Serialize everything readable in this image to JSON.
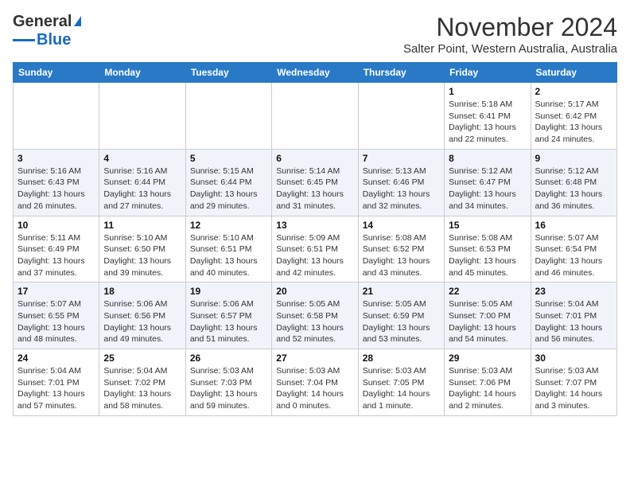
{
  "logo": {
    "line1": "General",
    "line2": "Blue"
  },
  "title": "November 2024",
  "subtitle": "Salter Point, Western Australia, Australia",
  "weekdays": [
    "Sunday",
    "Monday",
    "Tuesday",
    "Wednesday",
    "Thursday",
    "Friday",
    "Saturday"
  ],
  "weeks": [
    [
      {
        "day": "",
        "info": ""
      },
      {
        "day": "",
        "info": ""
      },
      {
        "day": "",
        "info": ""
      },
      {
        "day": "",
        "info": ""
      },
      {
        "day": "",
        "info": ""
      },
      {
        "day": "1",
        "info": "Sunrise: 5:18 AM\nSunset: 6:41 PM\nDaylight: 13 hours\nand 22 minutes."
      },
      {
        "day": "2",
        "info": "Sunrise: 5:17 AM\nSunset: 6:42 PM\nDaylight: 13 hours\nand 24 minutes."
      }
    ],
    [
      {
        "day": "3",
        "info": "Sunrise: 5:16 AM\nSunset: 6:43 PM\nDaylight: 13 hours\nand 26 minutes."
      },
      {
        "day": "4",
        "info": "Sunrise: 5:16 AM\nSunset: 6:44 PM\nDaylight: 13 hours\nand 27 minutes."
      },
      {
        "day": "5",
        "info": "Sunrise: 5:15 AM\nSunset: 6:44 PM\nDaylight: 13 hours\nand 29 minutes."
      },
      {
        "day": "6",
        "info": "Sunrise: 5:14 AM\nSunset: 6:45 PM\nDaylight: 13 hours\nand 31 minutes."
      },
      {
        "day": "7",
        "info": "Sunrise: 5:13 AM\nSunset: 6:46 PM\nDaylight: 13 hours\nand 32 minutes."
      },
      {
        "day": "8",
        "info": "Sunrise: 5:12 AM\nSunset: 6:47 PM\nDaylight: 13 hours\nand 34 minutes."
      },
      {
        "day": "9",
        "info": "Sunrise: 5:12 AM\nSunset: 6:48 PM\nDaylight: 13 hours\nand 36 minutes."
      }
    ],
    [
      {
        "day": "10",
        "info": "Sunrise: 5:11 AM\nSunset: 6:49 PM\nDaylight: 13 hours\nand 37 minutes."
      },
      {
        "day": "11",
        "info": "Sunrise: 5:10 AM\nSunset: 6:50 PM\nDaylight: 13 hours\nand 39 minutes."
      },
      {
        "day": "12",
        "info": "Sunrise: 5:10 AM\nSunset: 6:51 PM\nDaylight: 13 hours\nand 40 minutes."
      },
      {
        "day": "13",
        "info": "Sunrise: 5:09 AM\nSunset: 6:51 PM\nDaylight: 13 hours\nand 42 minutes."
      },
      {
        "day": "14",
        "info": "Sunrise: 5:08 AM\nSunset: 6:52 PM\nDaylight: 13 hours\nand 43 minutes."
      },
      {
        "day": "15",
        "info": "Sunrise: 5:08 AM\nSunset: 6:53 PM\nDaylight: 13 hours\nand 45 minutes."
      },
      {
        "day": "16",
        "info": "Sunrise: 5:07 AM\nSunset: 6:54 PM\nDaylight: 13 hours\nand 46 minutes."
      }
    ],
    [
      {
        "day": "17",
        "info": "Sunrise: 5:07 AM\nSunset: 6:55 PM\nDaylight: 13 hours\nand 48 minutes."
      },
      {
        "day": "18",
        "info": "Sunrise: 5:06 AM\nSunset: 6:56 PM\nDaylight: 13 hours\nand 49 minutes."
      },
      {
        "day": "19",
        "info": "Sunrise: 5:06 AM\nSunset: 6:57 PM\nDaylight: 13 hours\nand 51 minutes."
      },
      {
        "day": "20",
        "info": "Sunrise: 5:05 AM\nSunset: 6:58 PM\nDaylight: 13 hours\nand 52 minutes."
      },
      {
        "day": "21",
        "info": "Sunrise: 5:05 AM\nSunset: 6:59 PM\nDaylight: 13 hours\nand 53 minutes."
      },
      {
        "day": "22",
        "info": "Sunrise: 5:05 AM\nSunset: 7:00 PM\nDaylight: 13 hours\nand 54 minutes."
      },
      {
        "day": "23",
        "info": "Sunrise: 5:04 AM\nSunset: 7:01 PM\nDaylight: 13 hours\nand 56 minutes."
      }
    ],
    [
      {
        "day": "24",
        "info": "Sunrise: 5:04 AM\nSunset: 7:01 PM\nDaylight: 13 hours\nand 57 minutes."
      },
      {
        "day": "25",
        "info": "Sunrise: 5:04 AM\nSunset: 7:02 PM\nDaylight: 13 hours\nand 58 minutes."
      },
      {
        "day": "26",
        "info": "Sunrise: 5:03 AM\nSunset: 7:03 PM\nDaylight: 13 hours\nand 59 minutes."
      },
      {
        "day": "27",
        "info": "Sunrise: 5:03 AM\nSunset: 7:04 PM\nDaylight: 14 hours\nand 0 minutes."
      },
      {
        "day": "28",
        "info": "Sunrise: 5:03 AM\nSunset: 7:05 PM\nDaylight: 14 hours\nand 1 minute."
      },
      {
        "day": "29",
        "info": "Sunrise: 5:03 AM\nSunset: 7:06 PM\nDaylight: 14 hours\nand 2 minutes."
      },
      {
        "day": "30",
        "info": "Sunrise: 5:03 AM\nSunset: 7:07 PM\nDaylight: 14 hours\nand 3 minutes."
      }
    ]
  ]
}
